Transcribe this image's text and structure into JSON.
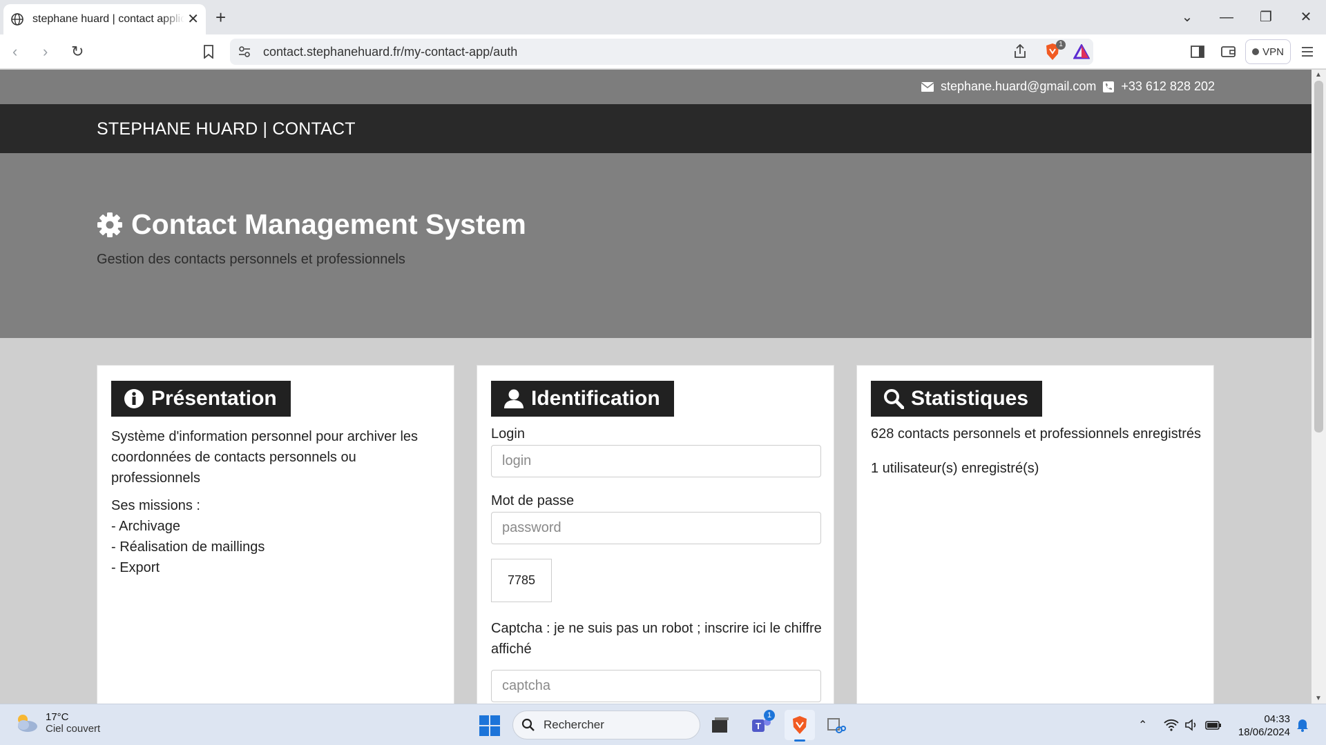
{
  "browser": {
    "tab_title": "stephane huard | contact applic",
    "url": "contact.stephanehuard.fr/my-contact-app/auth",
    "vpn_label": "VPN",
    "shield_badge": "1"
  },
  "header": {
    "email": "stephane.huard@gmail.com",
    "phone": "+33 612 828 202",
    "brand": "STEPHANE HUARD | CONTACT"
  },
  "hero": {
    "title": "Contact Management System",
    "subtitle": "Gestion des contacts personnels et professionnels"
  },
  "presentation": {
    "title": "Présentation",
    "text": "Système d'information personnel pour archiver les coordonnées de contacts personnels ou professionnels",
    "missions_heading": "Ses missions :",
    "missions": [
      "- Archivage",
      "- Réalisation de maillings",
      "- Export"
    ]
  },
  "identification": {
    "title": "Identification",
    "login_label": "Login",
    "login_placeholder": "login",
    "password_label": "Mot de passe",
    "password_placeholder": "password",
    "captcha_code": "7785",
    "captcha_label": "Captcha : je ne suis pas un robot ; inscrire ici le chiffre affiché",
    "captcha_placeholder": "captcha"
  },
  "statistiques": {
    "title": "Statistiques",
    "contacts": "628 contacts personnels et professionnels enregistrés",
    "users": "1 utilisateur(s) enregistré(s)"
  },
  "taskbar": {
    "temperature": "17°C",
    "weather": "Ciel couvert",
    "search_placeholder": "Rechercher",
    "teams_badge": "1",
    "time": "04:33",
    "date": "18/06/2024"
  }
}
